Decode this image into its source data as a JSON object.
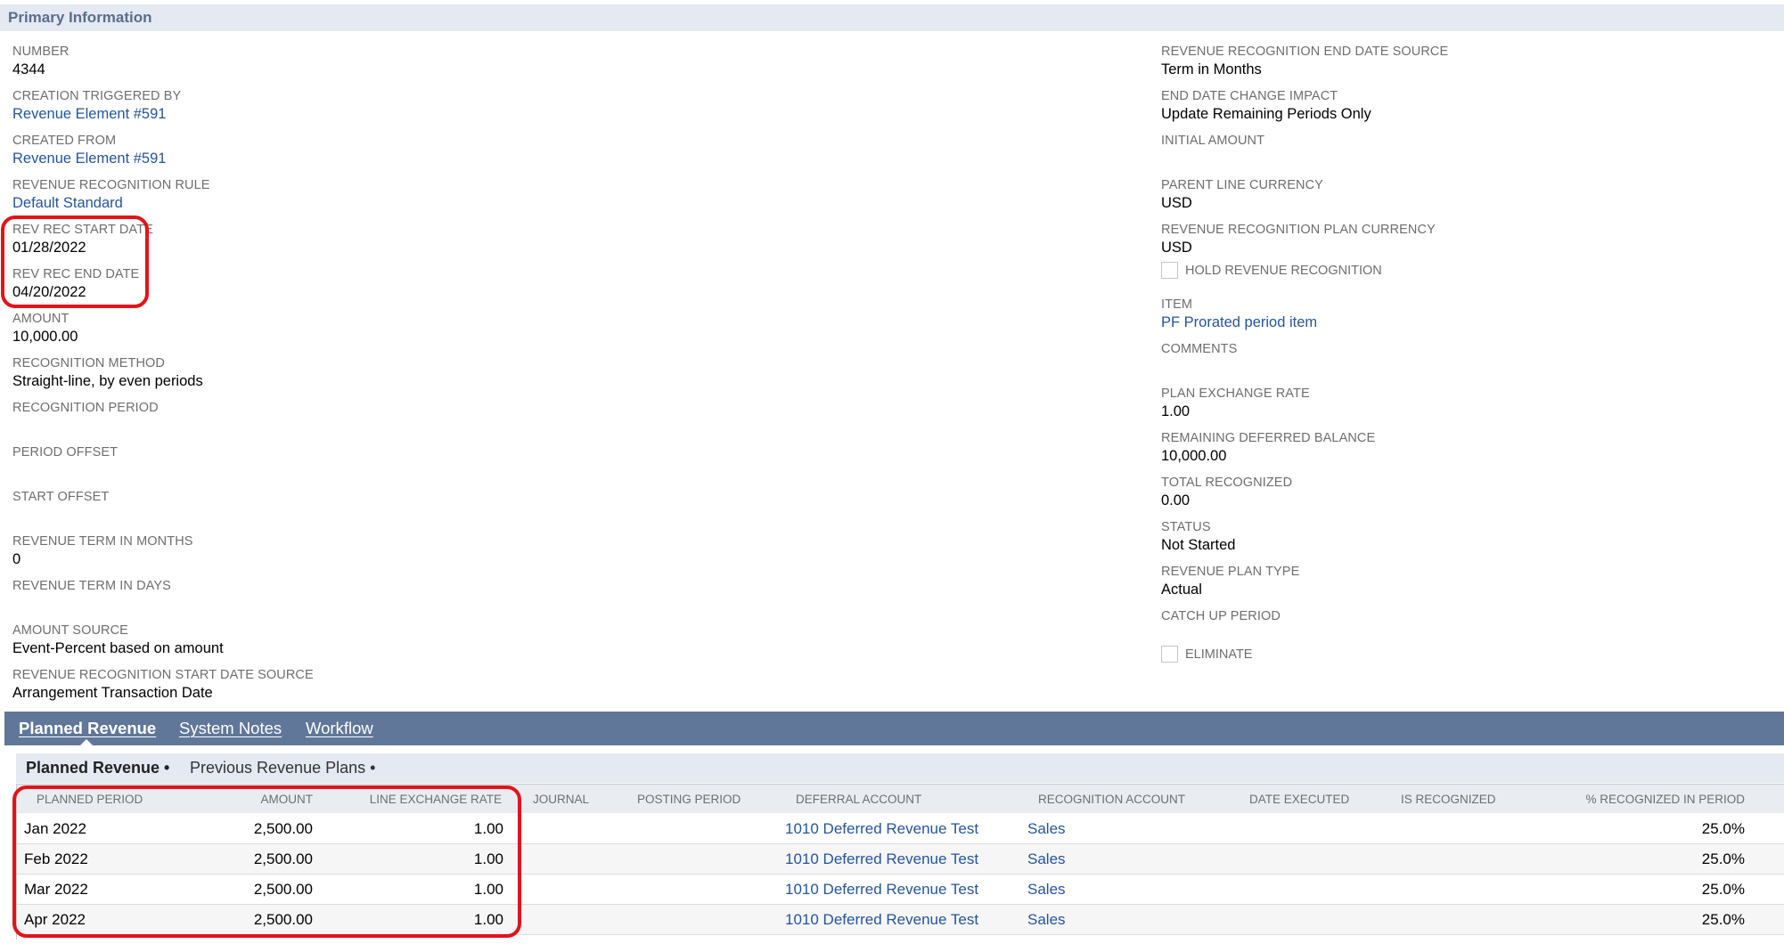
{
  "section": {
    "title": "Primary Information"
  },
  "left_fields": [
    {
      "label": "NUMBER",
      "value": "4344",
      "link": false
    },
    {
      "label": "CREATION TRIGGERED BY",
      "value": "Revenue Element #591",
      "link": true
    },
    {
      "label": "CREATED FROM",
      "value": "Revenue Element #591",
      "link": true
    },
    {
      "label": "REVENUE RECOGNITION RULE",
      "value": "Default Standard",
      "link": true
    },
    {
      "label": "REV REC START DATE",
      "value": "01/28/2022",
      "link": false
    },
    {
      "label": "REV REC END DATE",
      "value": "04/20/2022",
      "link": false
    },
    {
      "label": "AMOUNT",
      "value": "10,000.00",
      "link": false
    },
    {
      "label": "RECOGNITION METHOD",
      "value": "Straight-line, by even periods",
      "link": false
    },
    {
      "label": "RECOGNITION PERIOD",
      "value": "",
      "link": false
    },
    {
      "label": "PERIOD OFFSET",
      "value": "",
      "link": false
    },
    {
      "label": "START OFFSET",
      "value": "",
      "link": false
    },
    {
      "label": "REVENUE TERM IN MONTHS",
      "value": "0",
      "link": false
    },
    {
      "label": "REVENUE TERM IN DAYS",
      "value": "",
      "link": false
    },
    {
      "label": "AMOUNT SOURCE",
      "value": "Event-Percent based on amount",
      "link": false
    },
    {
      "label": "REVENUE RECOGNITION START DATE SOURCE",
      "value": "Arrangement Transaction Date",
      "link": false
    }
  ],
  "right_fields": [
    {
      "label": "REVENUE RECOGNITION END DATE SOURCE",
      "value": "Term in Months",
      "link": false
    },
    {
      "label": "END DATE CHANGE IMPACT",
      "value": "Update Remaining Periods Only",
      "link": false
    },
    {
      "label": "INITIAL AMOUNT",
      "value": "",
      "link": false
    },
    {
      "label": "PARENT LINE CURRENCY",
      "value": "USD",
      "link": false
    },
    {
      "label": "REVENUE RECOGNITION PLAN CURRENCY",
      "value": "USD",
      "link": false
    },
    {
      "label": "ITEM",
      "value": "PF Prorated period item",
      "link": true
    },
    {
      "label": "COMMENTS",
      "value": "",
      "link": false
    },
    {
      "label": "PLAN EXCHANGE RATE",
      "value": "1.00",
      "link": false
    },
    {
      "label": "REMAINING DEFERRED BALANCE",
      "value": "10,000.00",
      "link": false
    },
    {
      "label": "TOTAL RECOGNIZED",
      "value": "0.00",
      "link": false
    },
    {
      "label": "STATUS",
      "value": "Not Started",
      "link": false
    },
    {
      "label": "REVENUE PLAN TYPE",
      "value": "Actual",
      "link": false
    },
    {
      "label": "CATCH UP PERIOD",
      "value": "",
      "link": false
    }
  ],
  "checkboxes": [
    {
      "label": "HOLD REVENUE RECOGNITION",
      "checked": false
    },
    {
      "label": "ELIMINATE",
      "checked": false
    }
  ],
  "tabs": [
    {
      "label": "Planned Revenue",
      "active": true
    },
    {
      "label": "System Notes",
      "active": false
    },
    {
      "label": "Workflow",
      "active": false
    }
  ],
  "subtabs": [
    {
      "label": "Planned Revenue •",
      "active": true
    },
    {
      "label": "Previous Revenue Plans •",
      "active": false
    }
  ],
  "table": {
    "columns": [
      "PLANNED PERIOD",
      "AMOUNT",
      "LINE EXCHANGE RATE",
      "JOURNAL",
      "POSTING PERIOD",
      "DEFERRAL ACCOUNT",
      "RECOGNITION ACCOUNT",
      "DATE EXECUTED",
      "IS RECOGNIZED",
      "% RECOGNIZED IN PERIOD"
    ],
    "rows": [
      {
        "period": "Jan 2022",
        "amount": "2,500.00",
        "rate": "1.00",
        "journal": "",
        "posting_period": "",
        "deferral_account": "1010 Deferred Revenue Test",
        "recognition_account": "Sales",
        "date_executed": "",
        "is_recognized": "",
        "pct": "25.0%"
      },
      {
        "period": "Feb 2022",
        "amount": "2,500.00",
        "rate": "1.00",
        "journal": "",
        "posting_period": "",
        "deferral_account": "1010 Deferred Revenue Test",
        "recognition_account": "Sales",
        "date_executed": "",
        "is_recognized": "",
        "pct": "25.0%"
      },
      {
        "period": "Mar 2022",
        "amount": "2,500.00",
        "rate": "1.00",
        "journal": "",
        "posting_period": "",
        "deferral_account": "1010 Deferred Revenue Test",
        "recognition_account": "Sales",
        "date_executed": "",
        "is_recognized": "",
        "pct": "25.0%"
      },
      {
        "period": "Apr 2022",
        "amount": "2,500.00",
        "rate": "1.00",
        "journal": "",
        "posting_period": "",
        "deferral_account": "1010 Deferred Revenue Test",
        "recognition_account": "Sales",
        "date_executed": "",
        "is_recognized": "",
        "pct": "25.0%"
      }
    ]
  },
  "colors": {
    "link": "#255599",
    "tab_bar": "#607799",
    "header_bg": "#e4e9f2",
    "highlight": "#e3131a"
  }
}
